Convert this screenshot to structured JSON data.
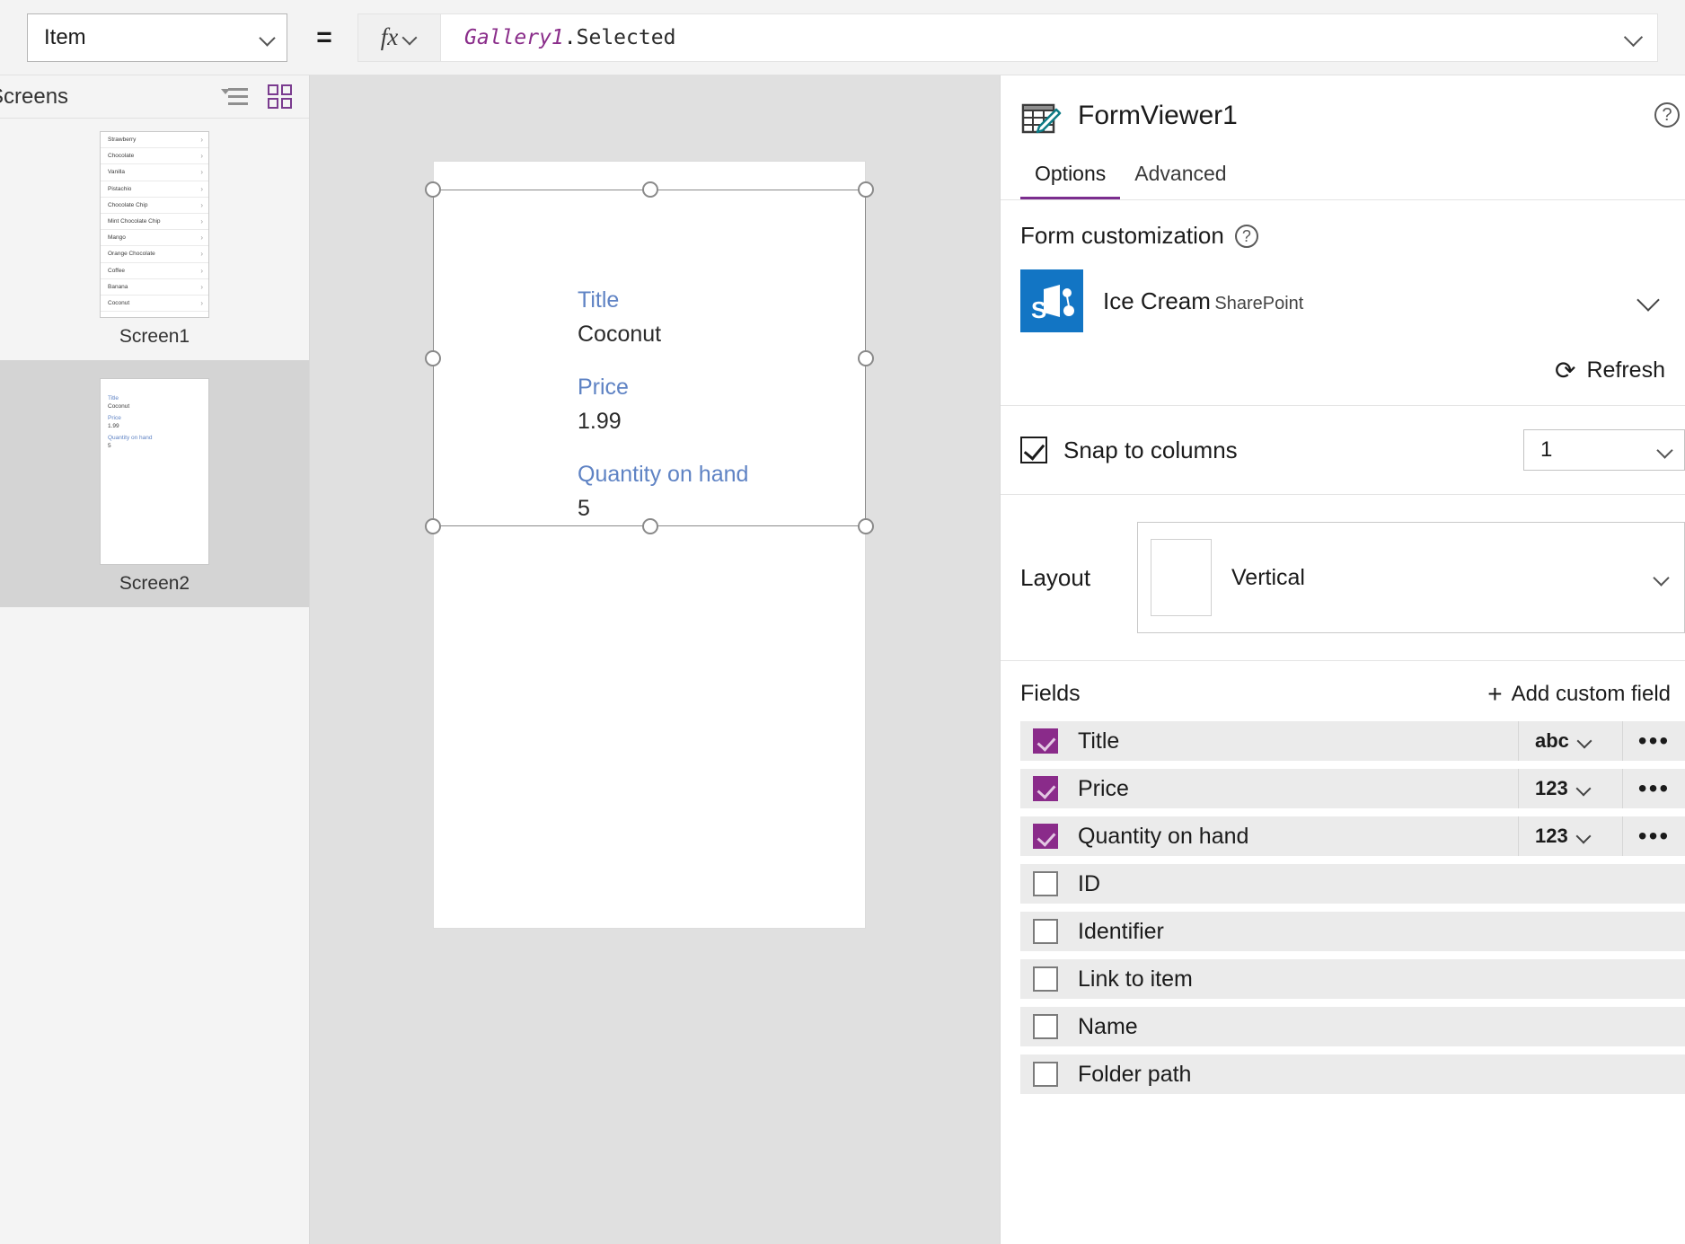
{
  "formula_bar": {
    "property_select": "Item",
    "equals": "=",
    "fx_icon": "fx-icon",
    "formula_object": "Gallery1",
    "formula_dot": ".",
    "formula_property": "Selected"
  },
  "left_pane": {
    "title": "Screens",
    "icons": [
      "tree-view-icon",
      "grid-view-icon"
    ],
    "screens": [
      {
        "label": "Screen1",
        "selected": false,
        "gallery_items": [
          "Strawberry",
          "Chocolate",
          "Vanilla",
          "Pistachio",
          "Chocolate Chip",
          "Mint Chocolate Chip",
          "Mango",
          "Orange Chocolate",
          "Coffee",
          "Banana",
          "Coconut"
        ]
      },
      {
        "label": "Screen2",
        "selected": true,
        "form_fields": [
          {
            "label": "Title",
            "value": "Coconut"
          },
          {
            "label": "Price",
            "value": "1.99"
          },
          {
            "label": "Quantity on hand",
            "value": "5"
          }
        ]
      }
    ]
  },
  "canvas": {
    "form_fields": [
      {
        "label": "Title",
        "value": "Coconut"
      },
      {
        "label": "Price",
        "value": "1.99"
      },
      {
        "label": "Quantity on hand",
        "value": "5"
      }
    ]
  },
  "right_pane": {
    "control_name": "FormViewer1",
    "control_icon": "form-edit-icon",
    "help_icon": "?",
    "tabs": [
      {
        "label": "Options",
        "active": true
      },
      {
        "label": "Advanced",
        "active": false
      }
    ],
    "form_customization": {
      "title": "Form customization",
      "help": "?",
      "data_source": {
        "name": "Ice Cream",
        "type": "SharePoint",
        "icon": "sharepoint-icon",
        "letter": "S"
      },
      "refresh_label": "Refresh",
      "refresh_icon": "refresh-icon"
    },
    "snap_to_columns": {
      "label": "Snap to columns",
      "checked": true,
      "columns": "1"
    },
    "layout": {
      "label": "Layout",
      "value": "Vertical",
      "preview_icon": "vertical-layout-icon"
    },
    "fields": {
      "title": "Fields",
      "add_label": "Add custom field",
      "add_icon": "plus-icon",
      "rows": [
        {
          "name": "Title",
          "checked": true,
          "type": "abc",
          "more": "•••"
        },
        {
          "name": "Price",
          "checked": true,
          "type": "123",
          "more": "•••"
        },
        {
          "name": "Quantity on hand",
          "checked": true,
          "type": "123",
          "more": "•••"
        },
        {
          "name": "ID",
          "checked": false,
          "type": "",
          "more": ""
        },
        {
          "name": "Identifier",
          "checked": false,
          "type": "",
          "more": ""
        },
        {
          "name": "Link to item",
          "checked": false,
          "type": "",
          "more": ""
        },
        {
          "name": "Name",
          "checked": false,
          "type": "",
          "more": ""
        },
        {
          "name": "Folder path",
          "checked": false,
          "type": "",
          "more": ""
        }
      ]
    }
  },
  "colors": {
    "accent_purple": "#7b2d8e",
    "checkbox_purple": "#8a2b8a",
    "label_blue": "#5f83c4",
    "sharepoint_blue": "#1275c4",
    "formula_object": "#8a2d8a"
  }
}
